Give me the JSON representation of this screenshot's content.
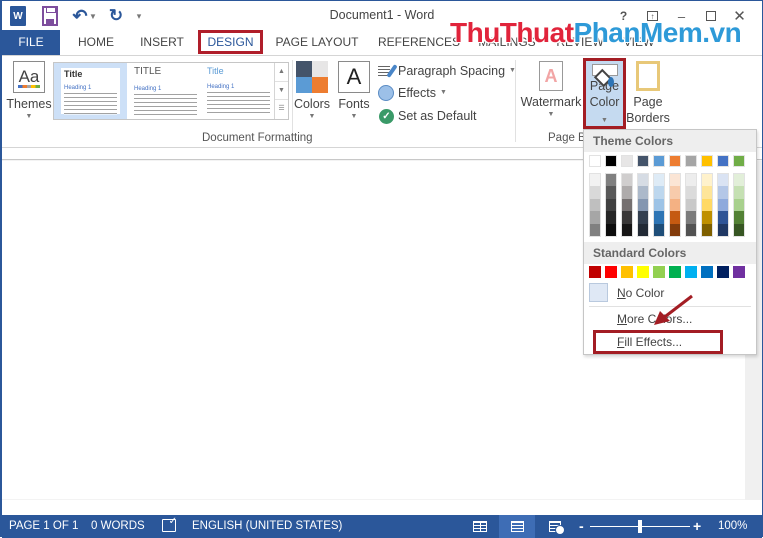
{
  "window": {
    "title": "Document1 - Word",
    "controls": [
      "help",
      "ribbon-display-options",
      "minimize",
      "restore",
      "close"
    ]
  },
  "qat": {
    "icons": [
      "word-logo-icon",
      "save-icon",
      "undo-icon",
      "redo-icon",
      "customize-qat-icon"
    ],
    "word_logo_text": "W"
  },
  "tabs": [
    {
      "label": "FILE",
      "active": false
    },
    {
      "label": "HOME",
      "active": false
    },
    {
      "label": "INSERT",
      "active": false
    },
    {
      "label": "DESIGN",
      "active": true,
      "highlighted": true
    },
    {
      "label": "PAGE LAYOUT",
      "active": false
    },
    {
      "label": "REFERENCES",
      "active": false
    },
    {
      "label": "MAILINGS",
      "active": false
    },
    {
      "label": "REVIEW",
      "active": false
    },
    {
      "label": "VIEW",
      "active": false
    }
  ],
  "brand_overlay": {
    "part1": "ThuThuat",
    "part2": "PhanMem.vn",
    "color1": "#e1243b",
    "color2": "#2e9ad8"
  },
  "ribbon": {
    "document_formatting": {
      "label": "Document Formatting",
      "themes_label": "Themes",
      "themes_icon_text": "Aa",
      "style_set": [
        {
          "title": "Title",
          "heading": "Heading 1",
          "selected": true
        },
        {
          "title": "TITLE",
          "heading": "Heading 1",
          "selected": false
        },
        {
          "title": "Title",
          "heading": "Heading 1",
          "selected": false
        }
      ],
      "colors_label": "Colors",
      "colors_swatches": [
        "#44546a",
        "#e7e6e6",
        "#5b9bd5",
        "#ed7d31"
      ],
      "fonts_label": "Fonts",
      "fonts_icon_text": "A",
      "paragraph_spacing_label": "Paragraph Spacing",
      "effects_label": "Effects",
      "set_as_default_label": "Set as Default"
    },
    "page_background": {
      "label": "Page B",
      "watermark_label": "Watermark",
      "watermark_icon_text": "A",
      "page_color_label_1": "Page",
      "page_color_label_2": "Color",
      "page_borders_label_1": "Page",
      "page_borders_label_2": "Borders"
    }
  },
  "page_color_menu": {
    "theme_colors_header": "Theme Colors",
    "theme_colors": [
      "#ffffff",
      "#000000",
      "#e7e6e6",
      "#44546a",
      "#5b9bd5",
      "#ed7d31",
      "#a5a5a5",
      "#ffc000",
      "#4472c4",
      "#70ad47"
    ],
    "theme_tints": [
      [
        "#f2f2f2",
        "#d9d9d9",
        "#bfbfbf",
        "#a6a6a6",
        "#808080"
      ],
      [
        "#808080",
        "#595959",
        "#404040",
        "#262626",
        "#0d0d0d"
      ],
      [
        "#d0cece",
        "#aeabab",
        "#757070",
        "#3a3838",
        "#171616"
      ],
      [
        "#d6dce4",
        "#acb9ca",
        "#8496b0",
        "#333f4f",
        "#222a35"
      ],
      [
        "#deebf6",
        "#bdd7ee",
        "#9dc3e6",
        "#2e75b5",
        "#1f4e79"
      ],
      [
        "#fbe5d5",
        "#f7cbac",
        "#f4b183",
        "#c55a11",
        "#833c0b"
      ],
      [
        "#ededed",
        "#dbdbdb",
        "#c9c9c9",
        "#7b7b7b",
        "#525252"
      ],
      [
        "#fff2cc",
        "#fee599",
        "#ffd965",
        "#bf9000",
        "#7f6000"
      ],
      [
        "#dae3f3",
        "#b4c7e7",
        "#8faadc",
        "#2f5496",
        "#203864"
      ],
      [
        "#e2efd9",
        "#c5e0b3",
        "#a8d08d",
        "#538135",
        "#375623"
      ]
    ],
    "standard_colors_header": "Standard Colors",
    "standard_colors": [
      "#c00000",
      "#ff0000",
      "#ffc000",
      "#ffff00",
      "#92d050",
      "#00b050",
      "#00b0f0",
      "#0070c0",
      "#002060",
      "#7030a0"
    ],
    "no_color_label": "No Color",
    "no_color_accesskey": "N",
    "more_colors_label": "More Colors...",
    "more_colors_accesskey": "M",
    "fill_effects_label": "Fill Effects...",
    "fill_effects_accesskey": "F",
    "fill_effects_highlighted": true
  },
  "statusbar": {
    "page": "PAGE 1 OF 1",
    "words": "0 WORDS",
    "language": "ENGLISH (UNITED STATES)",
    "zoom_minus": "-",
    "zoom_plus": "+",
    "zoom": "100%",
    "zoom_value_percent": 100,
    "active_view": "print-layout"
  }
}
